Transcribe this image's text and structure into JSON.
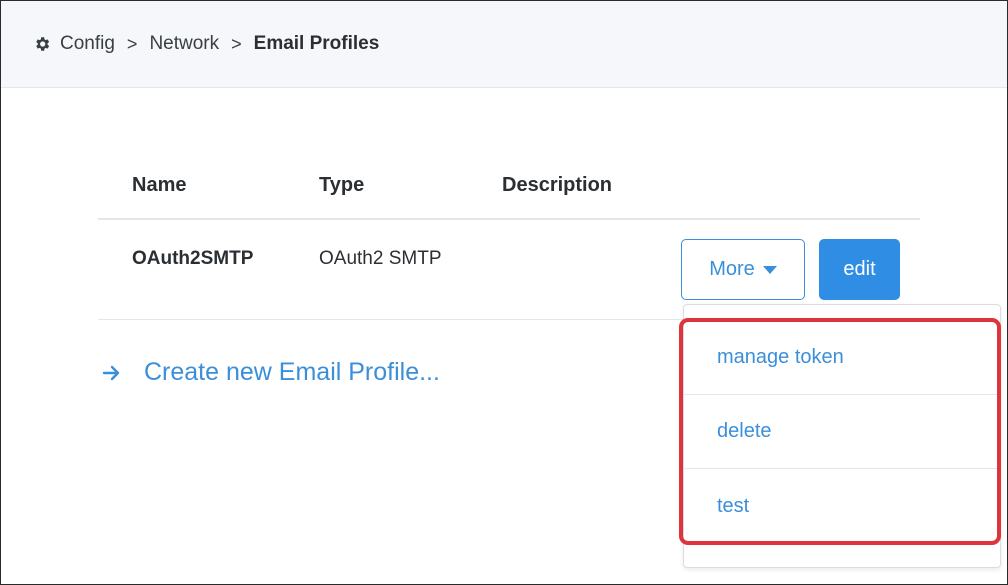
{
  "breadcrumb": {
    "items": [
      "Config",
      "Network"
    ],
    "current": "Email Profiles",
    "separator": ">",
    "icon": "gear-icon"
  },
  "table": {
    "headers": [
      "Name",
      "Type",
      "Description"
    ],
    "rows": [
      {
        "name": "OAuth2SMTP",
        "type": "OAuth2 SMTP",
        "description": ""
      }
    ],
    "more_label": "More",
    "edit_label": "edit"
  },
  "create_link": {
    "label": "Create new Email Profile...",
    "icon": "arrow-right-icon"
  },
  "dropdown": {
    "items": [
      "manage token",
      "delete",
      "test"
    ]
  },
  "colors": {
    "accent": "#3b8fd9",
    "edit_button": "#2f8de4",
    "highlight": "#e0343c"
  }
}
